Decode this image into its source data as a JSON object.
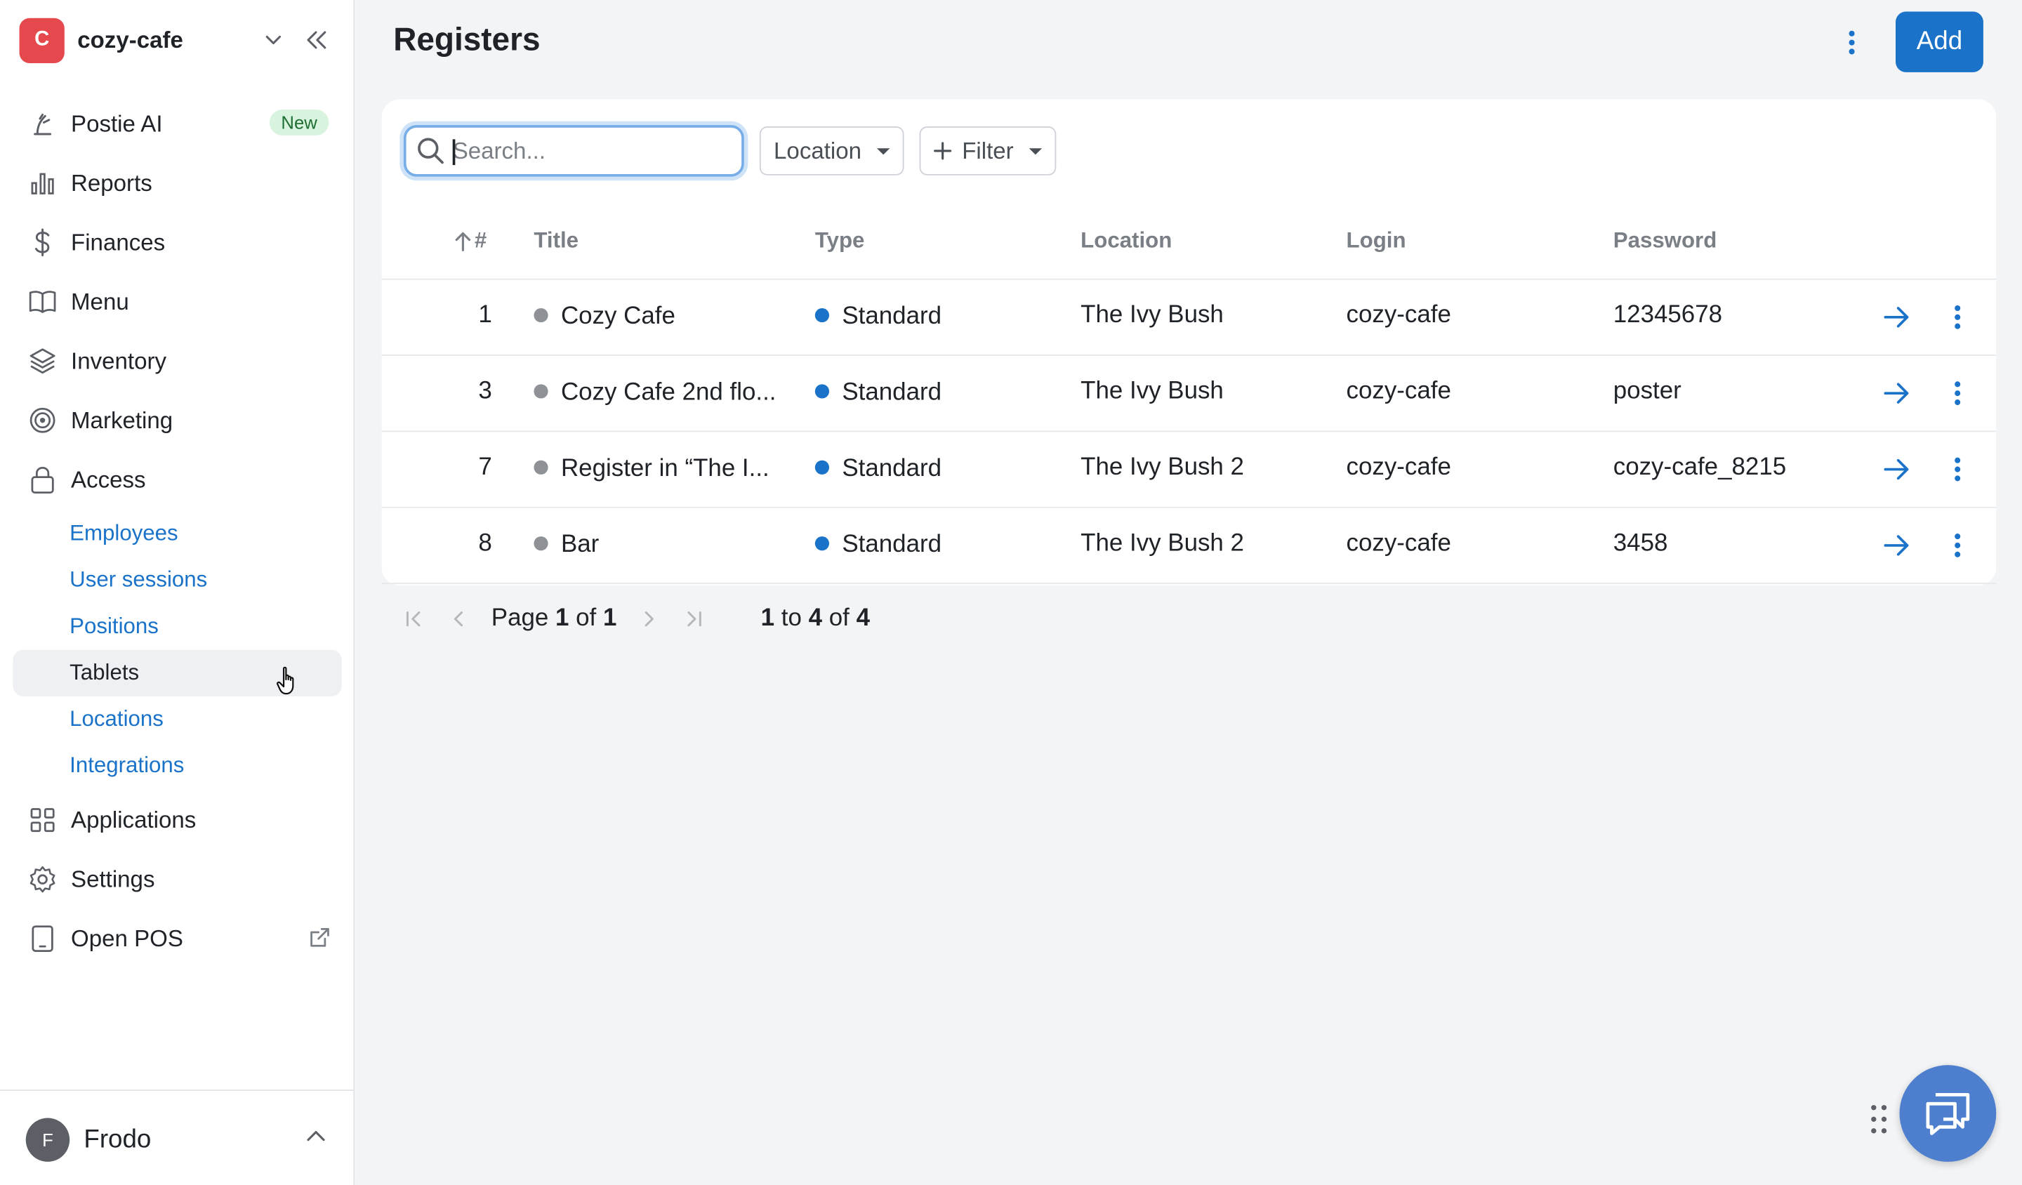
{
  "brand": {
    "initial": "C",
    "name": "cozy-cafe"
  },
  "sidebar": {
    "nav": [
      {
        "label": "Postie AI",
        "icon": "postie-icon",
        "badge": "New"
      },
      {
        "label": "Reports",
        "icon": "bar-chart-icon"
      },
      {
        "label": "Finances",
        "icon": "dollar-icon"
      },
      {
        "label": "Menu",
        "icon": "book-icon"
      },
      {
        "label": "Inventory",
        "icon": "layers-icon"
      },
      {
        "label": "Marketing",
        "icon": "target-icon"
      },
      {
        "label": "Access",
        "icon": "lock-icon"
      }
    ],
    "access_sub": [
      {
        "label": "Employees"
      },
      {
        "label": "User sessions"
      },
      {
        "label": "Positions"
      },
      {
        "label": "Tablets",
        "active": true
      },
      {
        "label": "Locations"
      },
      {
        "label": "Integrations"
      }
    ],
    "nav_bottom": [
      {
        "label": "Applications",
        "icon": "grid-icon"
      },
      {
        "label": "Settings",
        "icon": "gear-icon"
      },
      {
        "label": "Open POS",
        "icon": "tablet-icon",
        "external_icon": "external-link-icon"
      }
    ],
    "user": {
      "initial": "F",
      "name": "Frodo"
    }
  },
  "page": {
    "title": "Registers",
    "add_label": "Add"
  },
  "toolbar": {
    "search_placeholder": "Search...",
    "location_label": "Location",
    "filter_label": "Filter"
  },
  "table": {
    "columns": {
      "num": "#",
      "title": "Title",
      "type": "Type",
      "location": "Location",
      "login": "Login",
      "password": "Password"
    },
    "rows": [
      {
        "num": "1",
        "title": "Cozy Cafe",
        "type": "Standard",
        "location": "The Ivy Bush",
        "login": "cozy-cafe",
        "password": "12345678"
      },
      {
        "num": "3",
        "title": "Cozy Cafe 2nd flo...",
        "type": "Standard",
        "location": "The Ivy Bush",
        "login": "cozy-cafe",
        "password": "poster"
      },
      {
        "num": "7",
        "title": "Register in “The I...",
        "type": "Standard",
        "location": "The Ivy Bush 2",
        "login": "cozy-cafe",
        "password": "cozy-cafe_8215"
      },
      {
        "num": "8",
        "title": "Bar",
        "type": "Standard",
        "location": "The Ivy Bush 2",
        "login": "cozy-cafe",
        "password": "3458"
      }
    ]
  },
  "pagination": {
    "page_word": "Page",
    "current": "1",
    "of_word": "of",
    "total_pages": "1",
    "range_start": "1",
    "to_word": "to",
    "range_end": "4",
    "total_items": "4"
  },
  "colors": {
    "accent": "#1a73c9",
    "title_dot": "#8e9296",
    "type_dot": "#1a73c9",
    "brand": "#e5484d",
    "chat": "#4d7fce"
  }
}
